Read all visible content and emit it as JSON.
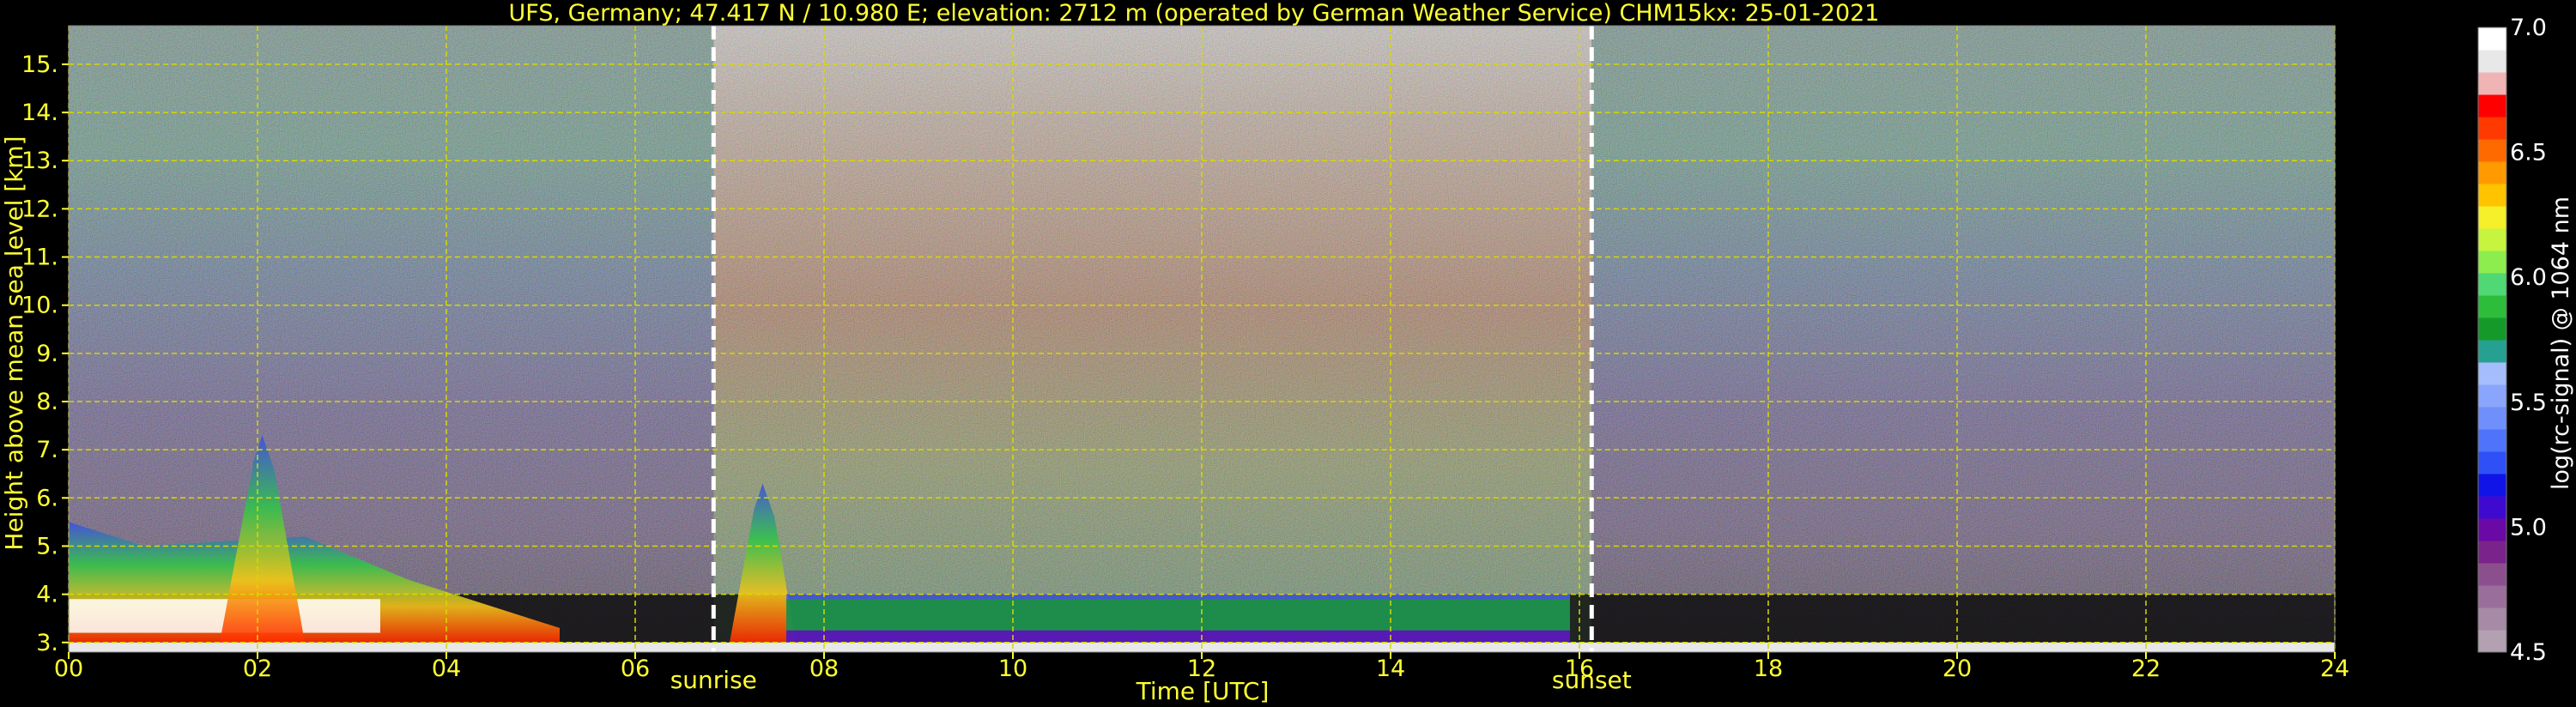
{
  "chart_data": {
    "type": "heatmap",
    "title": "UFS, Germany; 47.417 N / 10.980 E; elevation: 2712 m  (operated by German Weather Service)     CHM15kx: 25-01-2021",
    "xlabel": "Time [UTC]",
    "ylabel": "Height above mean sea level [km]",
    "xlim": [
      0,
      24
    ],
    "ylim": [
      2.8,
      15.8
    ],
    "x_ticks": [
      0,
      2,
      4,
      6,
      8,
      10,
      12,
      14,
      16,
      18,
      20,
      22,
      24
    ],
    "x_tick_labels": [
      "00",
      "02",
      "04",
      "06",
      "08",
      "10",
      "12",
      "14",
      "16",
      "18",
      "20",
      "22",
      "24"
    ],
    "y_ticks": [
      3,
      4,
      5,
      6,
      7,
      8,
      9,
      10,
      11,
      12,
      13,
      14,
      15
    ],
    "y_tick_labels": [
      "3.",
      "4.",
      "5.",
      "6.",
      "7.",
      "8.",
      "9.",
      "10.",
      "11.",
      "12.",
      "13.",
      "14.",
      "15."
    ],
    "grid": true,
    "annotations": [
      {
        "label": "sunrise",
        "x": 6.83
      },
      {
        "label": "sunset",
        "x": 16.13
      }
    ],
    "colorbar": {
      "label": "log(rc-signal) @ 1064 nm",
      "range": [
        4.5,
        7.0
      ],
      "ticks": [
        4.5,
        5.0,
        5.5,
        6.0,
        6.5,
        7.0
      ],
      "tick_labels": [
        "4.5",
        "5.0",
        "5.5",
        "6.0",
        "6.5",
        "7.0"
      ],
      "colors": [
        "#b3a1b1",
        "#a78aa6",
        "#9a6e9a",
        "#8c4f8e",
        "#7a238a",
        "#6a09a6",
        "#3f0ad0",
        "#1014e6",
        "#2f50f6",
        "#4f73fa",
        "#6f8ffb",
        "#8aa6fc",
        "#a5bdfd",
        "#26a090",
        "#159a2a",
        "#2dbd3a",
        "#4fd873",
        "#8ded4e",
        "#c7f43e",
        "#f5f02a",
        "#ffc300",
        "#ff9a00",
        "#ff6a00",
        "#ff3a00",
        "#ff0000",
        "#f0b4b4",
        "#e8e8e8",
        "#ffffff"
      ]
    },
    "features": [
      {
        "name": "night-aerosol-layer",
        "x_start": 0,
        "x_end": 5.2,
        "top_km": 5.5,
        "level": 6.3
      },
      {
        "name": "cloud-02",
        "x_start": 1.6,
        "x_end": 2.5,
        "top_km": 7.3,
        "level": 6.6
      },
      {
        "name": "cloud-07",
        "x_start": 7.0,
        "x_end": 7.7,
        "top_km": 6.3,
        "level": 6.7
      },
      {
        "name": "daytime-boundary-layer",
        "x_start": 7.6,
        "x_end": 15.9,
        "top_km": 4.0,
        "level": 5.8
      }
    ]
  }
}
